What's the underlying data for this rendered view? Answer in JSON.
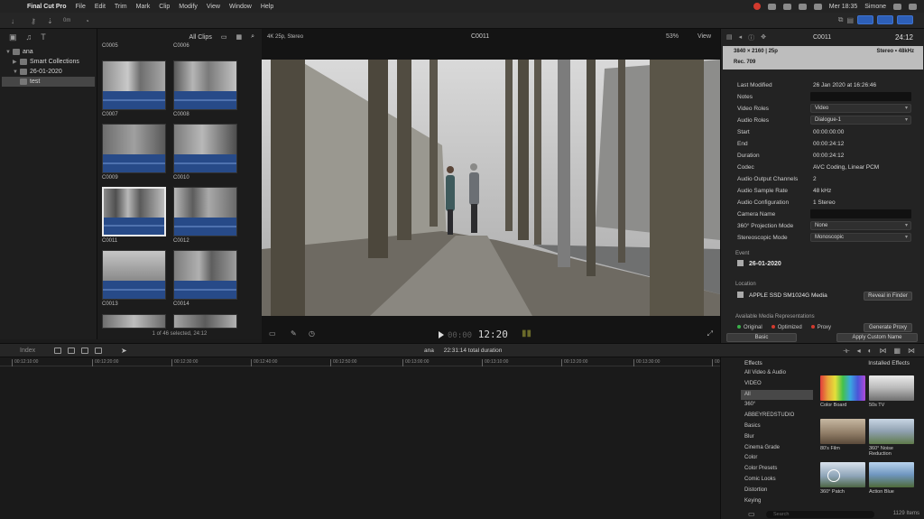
{
  "menubar": {
    "app": "Final Cut Pro",
    "items": [
      "File",
      "Edit",
      "Trim",
      "Mark",
      "Clip",
      "Modify",
      "View",
      "Window",
      "Help"
    ],
    "clock": "Mer 18:35",
    "user": "Simone"
  },
  "toolbar": {
    "keyword_label": "0m"
  },
  "sidebar": {
    "library": "ana",
    "items": [
      {
        "label": "Smart Collections"
      },
      {
        "label": "26-01-2020"
      },
      {
        "label": "test"
      }
    ]
  },
  "browser": {
    "filter": "All Clips",
    "clips": [
      {
        "name": "C0005"
      },
      {
        "name": "C0006"
      },
      {
        "name": "C0007"
      },
      {
        "name": "C0008"
      },
      {
        "name": "C0009"
      },
      {
        "name": "C0010"
      },
      {
        "name": "C0011"
      },
      {
        "name": "C0012"
      },
      {
        "name": "C0013"
      },
      {
        "name": "C0014"
      }
    ],
    "footer": "1 of 46 selected, 24:12"
  },
  "viewer": {
    "format": "4K 25p, Stereo",
    "clip_name": "C0011",
    "zoom": "53%",
    "view_label": "View",
    "timecode_dim": "00:00",
    "timecode": "12:20"
  },
  "inspector": {
    "clip_name": "C0011",
    "duration": "24:12",
    "summary": {
      "resolution": "3840 × 2160",
      "fps": "25p",
      "audio": "Stereo • 48kHz",
      "rec": "Rec. 709"
    },
    "rows": [
      {
        "key": "Last Modified",
        "value": "26 Jan 2020 at 16:26:46"
      },
      {
        "key": "Notes",
        "value": ""
      },
      {
        "key": "Video Roles",
        "value": "Video"
      },
      {
        "key": "Audio Roles",
        "value": "Dialogue-1"
      },
      {
        "key": "Start",
        "value": "00:00:00:00"
      },
      {
        "key": "End",
        "value": "00:00:24:12"
      },
      {
        "key": "Duration",
        "value": "00:00:24:12"
      },
      {
        "key": "Codec",
        "value": "AVC Coding, Linear PCM"
      },
      {
        "key": "Audio Output Channels",
        "value": "2"
      },
      {
        "key": "Audio Sample Rate",
        "value": "48 kHz"
      },
      {
        "key": "Audio Configuration",
        "value": "1 Stereo"
      },
      {
        "key": "Camera Name",
        "value": ""
      },
      {
        "key": "360° Projection Mode",
        "value": "None"
      },
      {
        "key": "Stereoscopic Mode",
        "value": "Monoscopic"
      }
    ],
    "event_label": "Event",
    "event_value": "26-01-2020",
    "location_label": "Location",
    "location_value": "APPLE SSD SM1024G Media",
    "reveal_button": "Reveal in Finder",
    "media_rep_label": "Available Media Representations",
    "media_original": "Original",
    "media_optimized": "Optimized",
    "media_proxy": "Proxy",
    "generate_proxy": "Generate Proxy",
    "basic_button": "Basic",
    "apply_name_button": "Apply Custom Name"
  },
  "timeline": {
    "index_label": "Index",
    "project": "ana",
    "total_duration": "22:31:14 total duration",
    "ruler": [
      "00:12:10:00",
      "00:12:20:00",
      "00:12:30:00",
      "00:12:40:00",
      "00:12:50:00",
      "00:13:00:00",
      "00:13:10:00",
      "00:13:20:00",
      "00:13:30:00",
      "00:13:40:00"
    ]
  },
  "effects": {
    "title": "Effects",
    "installed": "Installed Effects",
    "categories": [
      "All Video & Audio",
      "VIDEO",
      "All",
      "360°",
      "ABBEYREDSTUDIO",
      "Basics",
      "Blur",
      "Cinema Grade",
      "Color",
      "Color Presets",
      "Comic Looks",
      "Distortion",
      "Keying"
    ],
    "tiles": [
      {
        "label": "Color Board"
      },
      {
        "label": "50s TV"
      },
      {
        "label": "80's Film"
      },
      {
        "label": "360° Noise Reduction"
      },
      {
        "label": "360° Patch"
      },
      {
        "label": "Action Blue"
      }
    ],
    "search_placeholder": "Search",
    "count": "1129 Items"
  },
  "colors": {
    "accent_blue": "#2d5fb8",
    "waveform": "#274a88",
    "recording_red": "#d23a2e"
  }
}
